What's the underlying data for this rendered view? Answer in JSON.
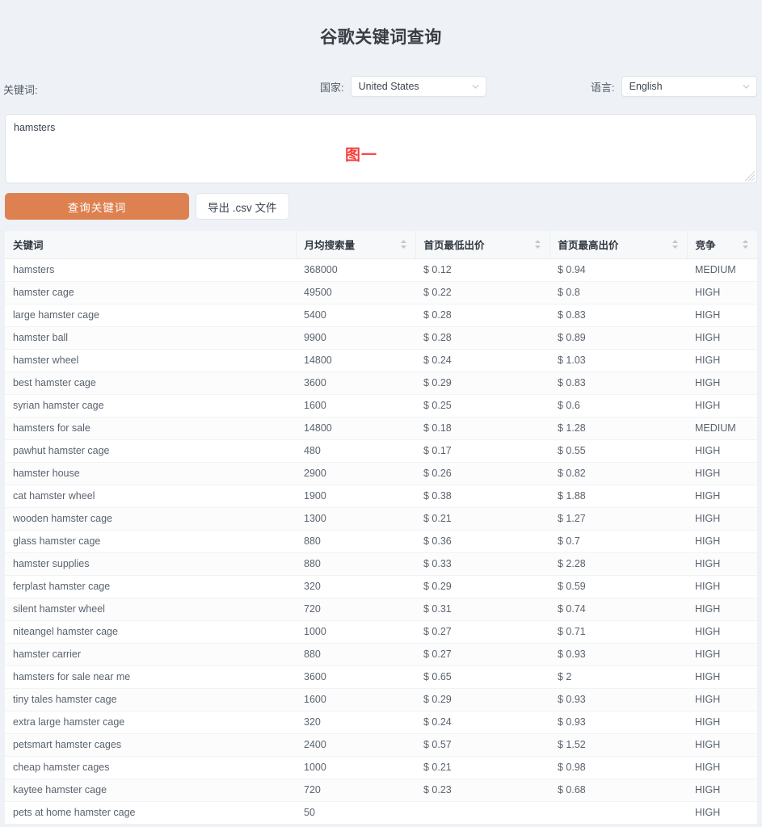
{
  "header": {
    "title": "谷歌关键词查询"
  },
  "form": {
    "keyword_label": "关键词:",
    "country": {
      "label": "国家:",
      "value": "United States"
    },
    "language": {
      "label": "语言:",
      "value": "English"
    },
    "textarea": {
      "value": "hamsters",
      "placeholder": ""
    },
    "annotation": "图一",
    "annotation_color": "#fb3b3b"
  },
  "actions": {
    "search_label": "查询关键词",
    "export_label": "导出 .csv 文件",
    "primary_color": "#dd8150"
  },
  "table": {
    "columns": [
      {
        "label": "关键词",
        "sortable": false
      },
      {
        "label": "月均搜索量",
        "sortable": true
      },
      {
        "label": "首页最低出价",
        "sortable": true
      },
      {
        "label": "首页最高出价",
        "sortable": true
      },
      {
        "label": "竞争",
        "sortable": true
      }
    ],
    "rows": [
      {
        "keyword": "hamsters",
        "volume": "368000",
        "low_bid": "$ 0.12",
        "high_bid": "$ 0.94",
        "competition": "MEDIUM"
      },
      {
        "keyword": "hamster cage",
        "volume": "49500",
        "low_bid": "$ 0.22",
        "high_bid": "$ 0.8",
        "competition": "HIGH"
      },
      {
        "keyword": "large hamster cage",
        "volume": "5400",
        "low_bid": "$ 0.28",
        "high_bid": "$ 0.83",
        "competition": "HIGH"
      },
      {
        "keyword": "hamster ball",
        "volume": "9900",
        "low_bid": "$ 0.28",
        "high_bid": "$ 0.89",
        "competition": "HIGH"
      },
      {
        "keyword": "hamster wheel",
        "volume": "14800",
        "low_bid": "$ 0.24",
        "high_bid": "$ 1.03",
        "competition": "HIGH"
      },
      {
        "keyword": "best hamster cage",
        "volume": "3600",
        "low_bid": "$ 0.29",
        "high_bid": "$ 0.83",
        "competition": "HIGH"
      },
      {
        "keyword": "syrian hamster cage",
        "volume": "1600",
        "low_bid": "$ 0.25",
        "high_bid": "$ 0.6",
        "competition": "HIGH"
      },
      {
        "keyword": "hamsters for sale",
        "volume": "14800",
        "low_bid": "$ 0.18",
        "high_bid": "$ 1.28",
        "competition": "MEDIUM"
      },
      {
        "keyword": "pawhut hamster cage",
        "volume": "480",
        "low_bid": "$ 0.17",
        "high_bid": "$ 0.55",
        "competition": "HIGH"
      },
      {
        "keyword": "hamster house",
        "volume": "2900",
        "low_bid": "$ 0.26",
        "high_bid": "$ 0.82",
        "competition": "HIGH"
      },
      {
        "keyword": "cat hamster wheel",
        "volume": "1900",
        "low_bid": "$ 0.38",
        "high_bid": "$ 1.88",
        "competition": "HIGH"
      },
      {
        "keyword": "wooden hamster cage",
        "volume": "1300",
        "low_bid": "$ 0.21",
        "high_bid": "$ 1.27",
        "competition": "HIGH"
      },
      {
        "keyword": "glass hamster cage",
        "volume": "880",
        "low_bid": "$ 0.36",
        "high_bid": "$ 0.7",
        "competition": "HIGH"
      },
      {
        "keyword": "hamster supplies",
        "volume": "880",
        "low_bid": "$ 0.33",
        "high_bid": "$ 2.28",
        "competition": "HIGH"
      },
      {
        "keyword": "ferplast hamster cage",
        "volume": "320",
        "low_bid": "$ 0.29",
        "high_bid": "$ 0.59",
        "competition": "HIGH"
      },
      {
        "keyword": "silent hamster wheel",
        "volume": "720",
        "low_bid": "$ 0.31",
        "high_bid": "$ 0.74",
        "competition": "HIGH"
      },
      {
        "keyword": "niteangel hamster cage",
        "volume": "1000",
        "low_bid": "$ 0.27",
        "high_bid": "$ 0.71",
        "competition": "HIGH"
      },
      {
        "keyword": "hamster carrier",
        "volume": "880",
        "low_bid": "$ 0.27",
        "high_bid": "$ 0.93",
        "competition": "HIGH"
      },
      {
        "keyword": "hamsters for sale near me",
        "volume": "3600",
        "low_bid": "$ 0.65",
        "high_bid": "$ 2",
        "competition": "HIGH"
      },
      {
        "keyword": "tiny tales hamster cage",
        "volume": "1600",
        "low_bid": "$ 0.29",
        "high_bid": "$ 0.93",
        "competition": "HIGH"
      },
      {
        "keyword": "extra large hamster cage",
        "volume": "320",
        "low_bid": "$ 0.24",
        "high_bid": "$ 0.93",
        "competition": "HIGH"
      },
      {
        "keyword": "petsmart hamster cages",
        "volume": "2400",
        "low_bid": "$ 0.57",
        "high_bid": "$ 1.52",
        "competition": "HIGH"
      },
      {
        "keyword": "cheap hamster cages",
        "volume": "1000",
        "low_bid": "$ 0.21",
        "high_bid": "$ 0.98",
        "competition": "HIGH"
      },
      {
        "keyword": "kaytee hamster cage",
        "volume": "720",
        "low_bid": "$ 0.23",
        "high_bid": "$ 0.68",
        "competition": "HIGH"
      },
      {
        "keyword": "pets at home hamster cage",
        "volume": "50",
        "low_bid": "",
        "high_bid": "",
        "competition": "HIGH"
      }
    ]
  }
}
